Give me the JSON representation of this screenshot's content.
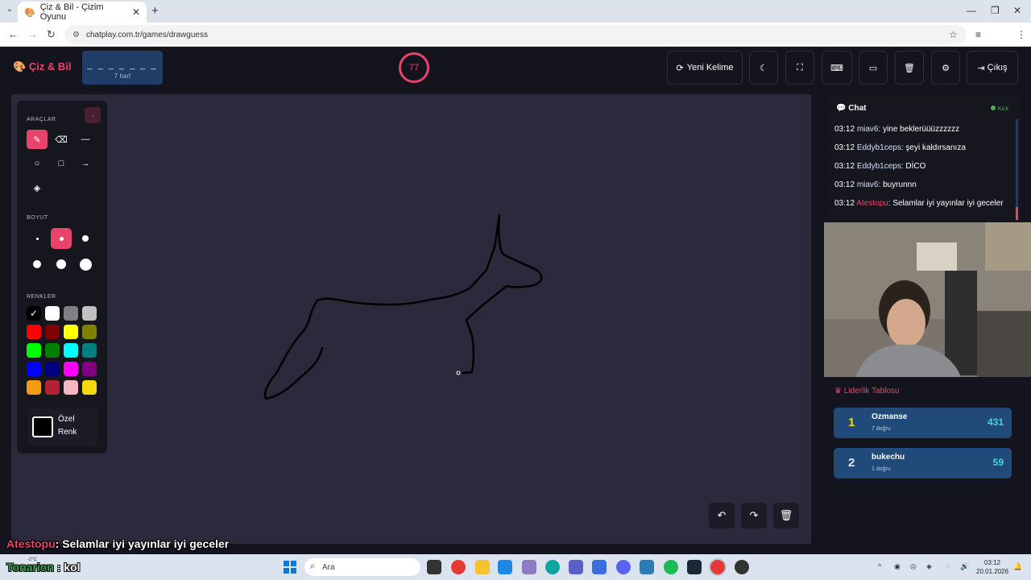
{
  "browser": {
    "tab_title": "Çiz & Bil - Çizim Oyunu",
    "url": "chatplay.com.tr/games/drawguess"
  },
  "header": {
    "logo": "Çiz & Bil",
    "word_mask": "_ _ _ _ _ _ _",
    "word_hint": "7 harf",
    "timer": "77",
    "new_word_label": "Yeni Kelime",
    "exit_label": "Çıkış"
  },
  "tools": {
    "title": "ARAÇLAR",
    "size_title": "BOYUT",
    "color_title": "RENKLER",
    "custom_color_line1": "Özel",
    "custom_color_line2": "Renk",
    "colors": [
      "#000000",
      "#ffffff",
      "#808080",
      "#c0c0c0",
      "#ff0000",
      "#800000",
      "#ffff00",
      "#808000",
      "#00ff00",
      "#008000",
      "#00ffff",
      "#008080",
      "#0000ff",
      "#000080",
      "#ff00ff",
      "#800080",
      "#f39c12",
      "#b22234",
      "#f4b6c2",
      "#f4d90f"
    ]
  },
  "chat": {
    "title": "Chat",
    "platform": "Kick",
    "messages": [
      {
        "time": "03:12",
        "user": "miav6",
        "text": "yine beklerüüüzzzzzz"
      },
      {
        "time": "03:12",
        "user": "Eddyb1ceps",
        "text": "şeyi kaldırsanıza"
      },
      {
        "time": "03:12",
        "user": "Eddyb1ceps",
        "text": "DİCO"
      },
      {
        "time": "03:12",
        "user": "miav6",
        "text": "buyrunnn"
      },
      {
        "time": "03:12",
        "user": "Atestopu",
        "text": "Selamlar iyi yayınlar iyi geceler"
      }
    ]
  },
  "leaderboard": {
    "title": "Liderlik Tablosu",
    "rows": [
      {
        "rank": "1",
        "name": "Ozmanse",
        "sub": "7 doğru",
        "score": "431"
      },
      {
        "rank": "2",
        "name": "bukechu",
        "sub": "1 doğru",
        "score": "59"
      }
    ]
  },
  "stream_overlay": {
    "user": "Atestopu",
    "message": ": Selamlar iyi yayınlar iyi geceler",
    "user2": "Tonarion",
    "message2": ": kol"
  },
  "taskbar": {
    "weather": "-2°C",
    "search_placeholder": "Ara",
    "time": "03:12",
    "date": "20.01.2026"
  }
}
